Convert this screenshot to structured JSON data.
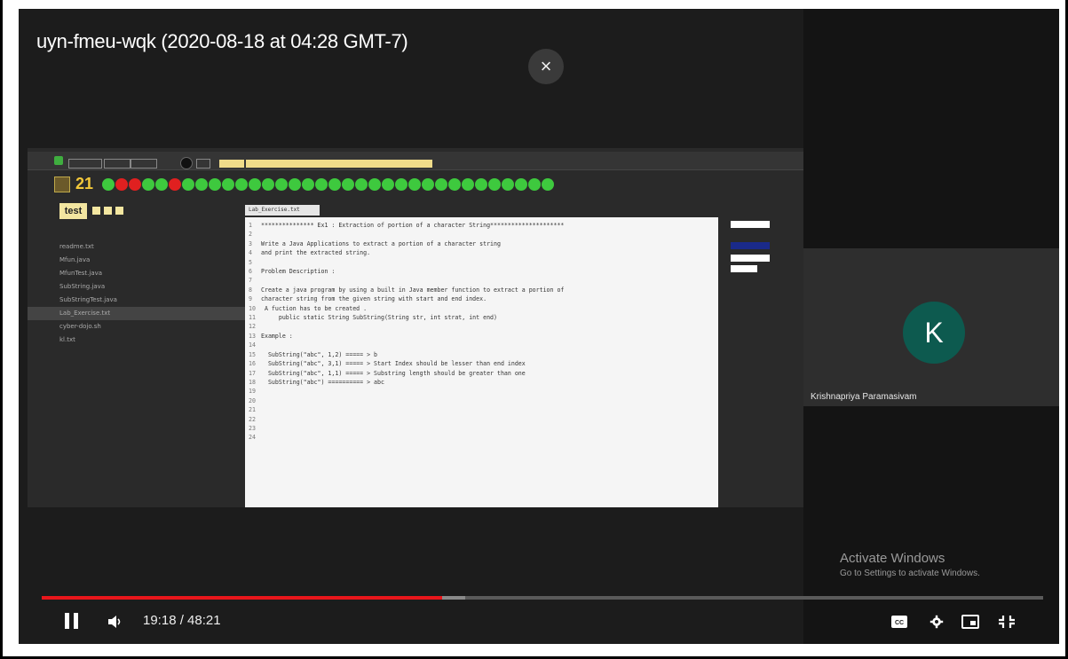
{
  "video": {
    "title": "uyn-fmeu-wqk (2020-08-18 at 04:28 GMT-7)",
    "close_glyph": "×",
    "time_display": "19:18 / 48:21",
    "progress_fraction": 0.4,
    "buffered_fraction": 0.423
  },
  "participant": {
    "initial": "K",
    "name": "Krishnapriya Paramasivam",
    "avatar_color": "#0d5a4f"
  },
  "watermark": {
    "line1": "Activate Windows",
    "line2": "Go to Settings to activate Windows."
  },
  "shared_screen": {
    "score": "21",
    "test_button": "test",
    "dots": [
      "green",
      "red",
      "red",
      "green",
      "green",
      "red",
      "green",
      "green",
      "green",
      "green",
      "green",
      "green",
      "green",
      "green",
      "green",
      "green",
      "green",
      "green",
      "green",
      "green",
      "green",
      "green",
      "green",
      "green",
      "green",
      "green",
      "green",
      "green",
      "green",
      "green",
      "green",
      "green",
      "green",
      "green"
    ],
    "file_tab": "Lab_Exercise.txt",
    "files": [
      "readme.txt",
      "Mfun.java",
      "MfunTest.java",
      "SubString.java",
      "SubStringTest.java",
      "Lab_Exercise.txt",
      "cyber-dojo.sh",
      "kl.txt"
    ],
    "selected_file_index": 5,
    "code_lines": [
      {
        "n": "1",
        "t": "*************** Ex1 : Extraction of portion of a character String*********************"
      },
      {
        "n": "2",
        "t": ""
      },
      {
        "n": "3",
        "t": "Write a Java Applications to extract a portion of a character string"
      },
      {
        "n": "4",
        "t": "and print the extracted string."
      },
      {
        "n": "5",
        "t": ""
      },
      {
        "n": "6",
        "t": "Problem Description :"
      },
      {
        "n": "7",
        "t": ""
      },
      {
        "n": "8",
        "t": "Create a java program by using a built in Java member function to extract a portion of"
      },
      {
        "n": "9",
        "t": "character string from the given string with start and end index."
      },
      {
        "n": "10",
        "t": " A fuction has to be created ."
      },
      {
        "n": "11",
        "t": "     public static String SubString(String str, int strat, int end)"
      },
      {
        "n": "12",
        "t": ""
      },
      {
        "n": "13",
        "t": "Example :"
      },
      {
        "n": "14",
        "t": ""
      },
      {
        "n": "15",
        "t": "  SubString(\"abc\", 1,2) ===== > b"
      },
      {
        "n": "16",
        "t": "  SubString(\"abc\", 3,1) ===== > Start Index should be lesser than end index"
      },
      {
        "n": "17",
        "t": "  SubString(\"abc\", 1,1) ===== > Substring length should be greater than one"
      },
      {
        "n": "18",
        "t": "  SubString(\"abc\") ========== > abc"
      },
      {
        "n": "19",
        "t": ""
      },
      {
        "n": "20",
        "t": ""
      },
      {
        "n": "21",
        "t": ""
      },
      {
        "n": "22",
        "t": ""
      },
      {
        "n": "23",
        "t": ""
      },
      {
        "n": "24",
        "t": ""
      }
    ]
  },
  "colors": {
    "progress": "#e8161b",
    "dot_green": "#3ec93e",
    "dot_red": "#e02020"
  }
}
